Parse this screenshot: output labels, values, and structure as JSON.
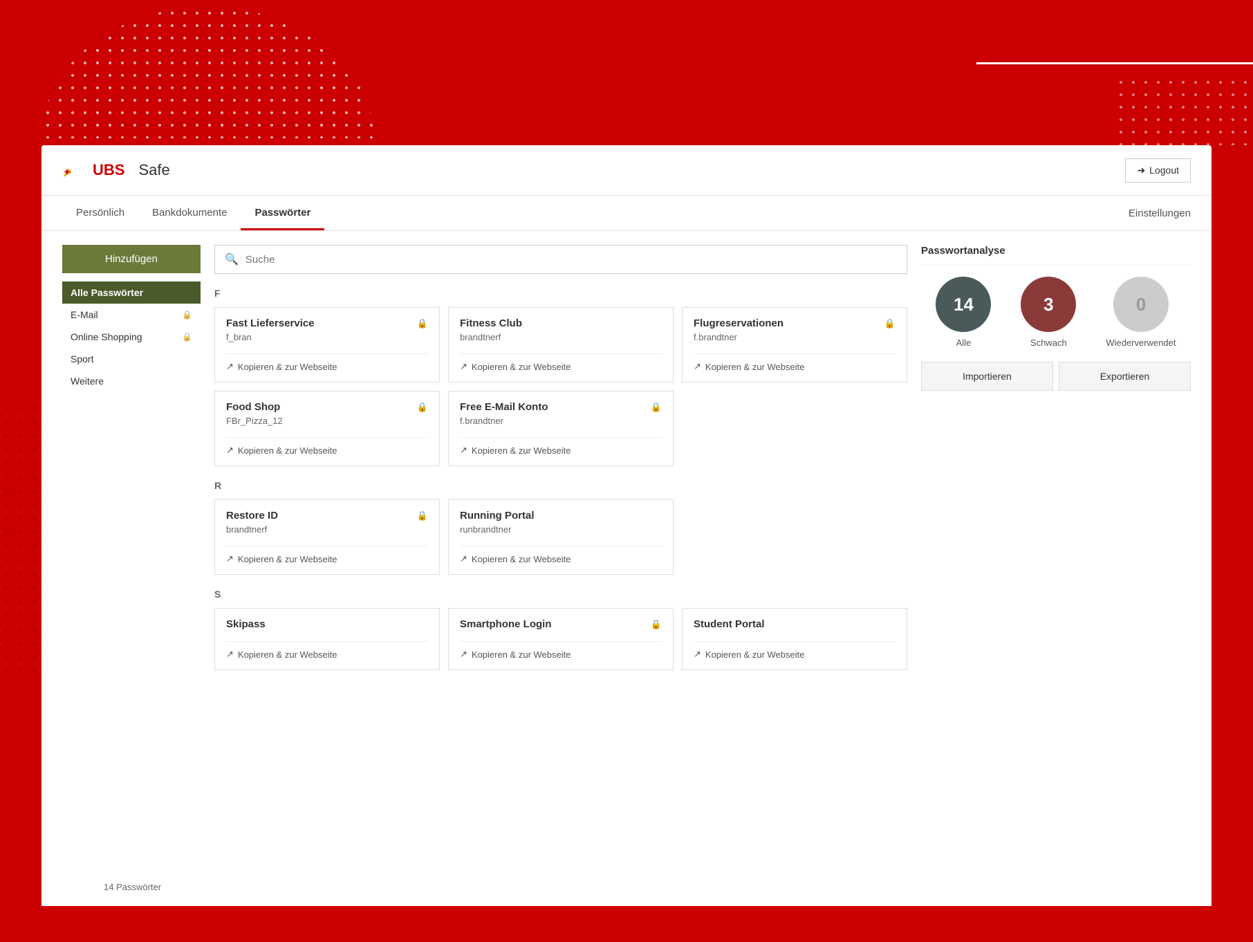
{
  "header": {
    "logo_text": "UBS",
    "title": "Safe",
    "logout_label": "Logout"
  },
  "nav": {
    "tabs": [
      {
        "id": "persoenlich",
        "label": "Persönlich",
        "active": false
      },
      {
        "id": "bankdokumente",
        "label": "Bankdokumente",
        "active": false
      },
      {
        "id": "passwoerter",
        "label": "Passwörter",
        "active": true
      }
    ],
    "settings_label": "Einstellungen"
  },
  "sidebar": {
    "add_button_label": "Hinzufügen",
    "items": [
      {
        "id": "alle",
        "label": "Alle Passwörter",
        "active": true,
        "has_lock": false
      },
      {
        "id": "email",
        "label": "E-Mail",
        "active": false,
        "has_lock": true
      },
      {
        "id": "online-shopping",
        "label": "Online Shopping",
        "active": false,
        "has_lock": true
      },
      {
        "id": "sport",
        "label": "Sport",
        "active": false,
        "has_lock": false
      },
      {
        "id": "weitere",
        "label": "Weitere",
        "active": false,
        "has_lock": false
      }
    ],
    "count_label": "14 Passwörter"
  },
  "search": {
    "placeholder": "Suche"
  },
  "sections": [
    {
      "letter": "F",
      "cards": [
        {
          "title": "Fast Lieferservice",
          "username": "f_bran",
          "action": "Kopieren & zur Webseite",
          "has_lock": true
        },
        {
          "title": "Fitness Club",
          "username": "brandtnerf",
          "action": "Kopieren & zur Webseite",
          "has_lock": false
        },
        {
          "title": "Flugreservationen",
          "username": "f.brandtner",
          "action": "Kopieren & zur Webseite",
          "has_lock": true
        },
        {
          "title": "Food Shop",
          "username": "FBr_Pizza_12",
          "action": "Kopieren & zur Webseite",
          "has_lock": true
        },
        {
          "title": "Free E-Mail Konto",
          "username": "f.brandtner",
          "action": "Kopieren & zur Webseite",
          "has_lock": true
        }
      ]
    },
    {
      "letter": "R",
      "cards": [
        {
          "title": "Restore ID",
          "username": "brandtnerf",
          "action": "Kopieren & zur Webseite",
          "has_lock": true
        },
        {
          "title": "Running Portal",
          "username": "runbrandtner",
          "action": "Kopieren & zur Webseite",
          "has_lock": false
        }
      ]
    },
    {
      "letter": "S",
      "cards": [
        {
          "title": "Skipass",
          "username": "",
          "action": "Kopieren & zur Webseite",
          "has_lock": false
        },
        {
          "title": "Smartphone Login",
          "username": "",
          "action": "Kopieren & zur Webseite",
          "has_lock": true
        },
        {
          "title": "Student Portal",
          "username": "",
          "action": "Kopieren & zur Webseite",
          "has_lock": false
        }
      ]
    }
  ],
  "analysis": {
    "title": "Passwortanalyse",
    "circles": [
      {
        "id": "all",
        "count": "14",
        "label": "Alle",
        "type": "all"
      },
      {
        "id": "weak",
        "count": "3",
        "label": "Schwach",
        "type": "weak"
      },
      {
        "id": "reused",
        "count": "0",
        "label": "Wiederverwendet",
        "type": "reused"
      }
    ],
    "import_label": "Importieren",
    "export_label": "Exportieren"
  }
}
